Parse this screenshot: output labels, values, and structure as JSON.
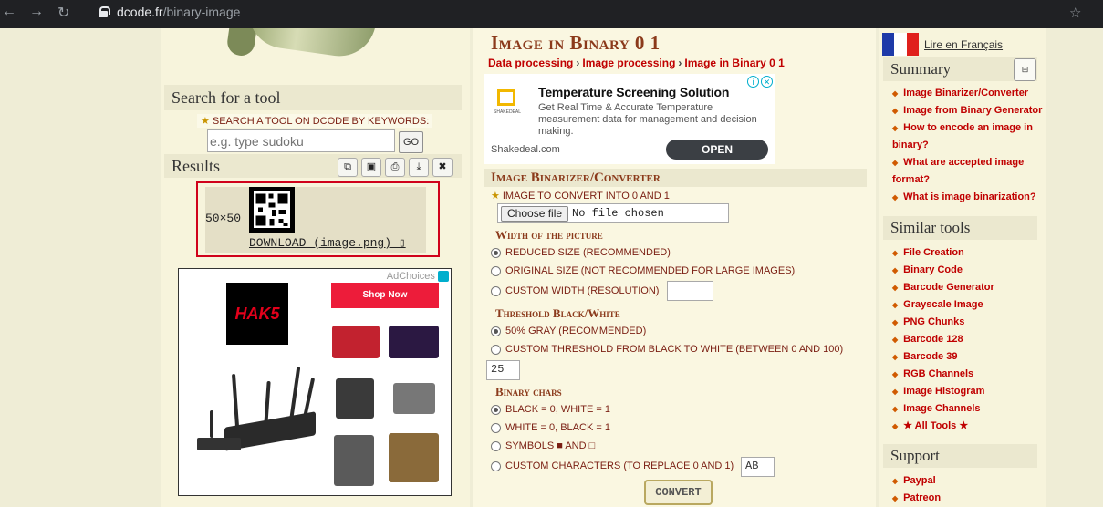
{
  "browser": {
    "url_host": "dcode.fr",
    "url_path": "/binary-image"
  },
  "left": {
    "search_title": "Search for a tool",
    "search_label": "SEARCH A TOOL ON DCODE BY KEYWORDS:",
    "search_placeholder": "e.g. type sudoku",
    "go_label": "GO",
    "results_title": "Results",
    "result_size": "50×50",
    "result_download": "DOWNLOAD (image.png) ▯",
    "ad": {
      "adchoices": "AdChoices",
      "hak5_logo": "HAK5",
      "shop_now": "Shop Now"
    }
  },
  "main": {
    "title": "Image in Binary 0 1",
    "breadcrumb": [
      "Data processing",
      "Image processing",
      "Image in Binary 0 1"
    ],
    "promo": {
      "heading": "Temperature Screening Solution",
      "description": "Get Real Time & Accurate Temperature measurement data for management and decision making.",
      "logo_text": "SHAKEDEAL",
      "site": "Shakedeal.com",
      "open_label": "OPEN"
    },
    "converter_title": "Image Binarizer/Converter",
    "file_label": "IMAGE TO CONVERT INTO 0 AND 1",
    "file_button": "Choose file",
    "file_status": "No file chosen",
    "width_title": "Width of the picture",
    "width_options": [
      "REDUCED SIZE (RECOMMENDED)",
      "ORIGINAL SIZE (NOT RECOMMENDED FOR LARGE IMAGES)",
      "CUSTOM WIDTH (RESOLUTION)"
    ],
    "threshold_title": "Threshold Black/White",
    "threshold_options": [
      "50% GRAY (RECOMMENDED)",
      "CUSTOM THRESHOLD FROM BLACK TO WHITE (BETWEEN 0 AND 100)"
    ],
    "threshold_value": "25",
    "chars_title": "Binary chars",
    "chars_options": [
      "BLACK = 0, WHITE = 1",
      "WHITE = 0, BLACK = 1",
      "SYMBOLS ■ AND □",
      "CUSTOM CHARACTERS (TO REPLACE 0 AND 1)"
    ],
    "custom_chars_value": "AB",
    "convert_label": "CONVERT"
  },
  "right": {
    "lang_link": "Lire en Français",
    "summary_title": "Summary",
    "summary_links": [
      "Image Binarizer/Converter",
      "Image from Binary Generator",
      "How to encode an image in binary?",
      "What are accepted image format?",
      "What is image binarization?"
    ],
    "similar_title": "Similar tools",
    "similar_links": [
      "File Creation",
      "Binary Code",
      "Barcode Generator",
      "Grayscale Image",
      "PNG Chunks",
      "Barcode 128",
      "Barcode 39",
      "RGB Channels",
      "Image Histogram",
      "Image Channels",
      "★ All Tools ★"
    ],
    "support_title": "Support",
    "support_links": [
      "Paypal",
      "Patreon"
    ]
  },
  "colors": {
    "accent_red": "#c00000",
    "title_brown": "#8b3a1b",
    "highlight_border": "#d0021b"
  }
}
